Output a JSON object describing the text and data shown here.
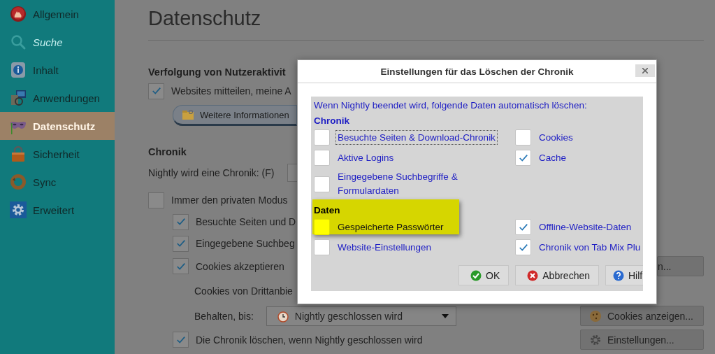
{
  "sidebar": {
    "items": [
      {
        "label": "Allgemein",
        "kind": "flame",
        "selected": false,
        "disabled": false
      },
      {
        "label": "Suche",
        "kind": "search",
        "selected": false,
        "disabled": true
      },
      {
        "label": "Inhalt",
        "kind": "info",
        "selected": false,
        "disabled": false
      },
      {
        "label": "Anwendungen",
        "kind": "apps",
        "selected": false,
        "disabled": false
      },
      {
        "label": "Datenschutz",
        "kind": "mask",
        "selected": true,
        "disabled": false
      },
      {
        "label": "Sicherheit",
        "kind": "lock",
        "selected": false,
        "disabled": false
      },
      {
        "label": "Sync",
        "kind": "sync",
        "selected": false,
        "disabled": false
      },
      {
        "label": "Erweitert",
        "kind": "gear",
        "selected": false,
        "disabled": false
      }
    ]
  },
  "content": {
    "title": "Datenschutz",
    "rows": [
      {
        "kind": "heading",
        "text": "Verfolgung von Nutzeraktivit"
      },
      {
        "kind": "checkbox",
        "label": "Websites mitteilen, meine A",
        "checked": true,
        "children": [
          {
            "kind": "button",
            "label": "Weitere Informationen"
          }
        ]
      },
      {
        "kind": "heading",
        "text": "Chronik"
      },
      {
        "kind": "select",
        "label": "Nightly wird eine Chronik: (F)"
      },
      {
        "kind": "checkbox",
        "label": "Immer den privaten Modus",
        "checked": false,
        "children": [
          {
            "kind": "checkbox",
            "label": "Besuchte Seiten und D",
            "checked": true
          },
          {
            "kind": "checkbox",
            "label": "Eingegebene Suchbeg",
            "checked": true
          },
          {
            "kind": "checkbox",
            "label": "Cookies akzeptieren",
            "checked": true,
            "side_button": {
              "label": "n...",
              "kind": "plain"
            }
          },
          {
            "kind": "text",
            "text": "Cookies von Drittanbie"
          },
          {
            "kind": "select",
            "label": "Behalten, bis:",
            "value": "Nightly geschlossen wird",
            "side_button": {
              "label": "Cookies anzeigen...",
              "kind": "cookie"
            }
          },
          {
            "kind": "checkbox",
            "label": "Die Chronik löschen, wenn Nightly geschlossen wird",
            "checked": true,
            "side_button": {
              "label": "Einstellungen...",
              "kind": "gear"
            }
          }
        ]
      }
    ]
  },
  "dialog": {
    "title": "Einstellungen für das Löschen der Chronik",
    "intro": "Wenn Nightly beendet wird, folgende Daten automatisch löschen:",
    "groups": [
      {
        "heading": "Chronik",
        "highlighted": false,
        "items": [
          {
            "label": "Besuchte Seiten & Download-Chronik",
            "checked": false,
            "focused": true,
            "highlighted": false
          },
          {
            "label": "Cookies",
            "checked": false,
            "focused": false,
            "highlighted": false
          },
          {
            "label": "Aktive Logins",
            "checked": false,
            "focused": false,
            "highlighted": false
          },
          {
            "label": "Cache",
            "checked": true,
            "focused": false,
            "highlighted": false
          },
          {
            "label": "Eingegebene Suchbegriffe & Formulardaten",
            "checked": false,
            "focused": false,
            "highlighted": false
          }
        ]
      },
      {
        "heading": "Daten",
        "highlighted": true,
        "items": [
          {
            "label": "Gespeicherte Passwörter",
            "checked": false,
            "focused": false,
            "highlighted": true
          },
          {
            "label": "Offline-Website-Daten",
            "checked": true,
            "focused": false,
            "highlighted": false
          },
          {
            "label": "Website-Einstellungen",
            "checked": false,
            "focused": false,
            "highlighted": false
          },
          {
            "label": "Chronik von Tab Mix Plu",
            "checked": true,
            "focused": false,
            "highlighted": false
          }
        ]
      }
    ],
    "buttons": [
      {
        "label": "OK",
        "kind": "ok"
      },
      {
        "label": "Abbrechen",
        "kind": "cancel"
      },
      {
        "label": "Hilf",
        "kind": "help"
      }
    ]
  }
}
